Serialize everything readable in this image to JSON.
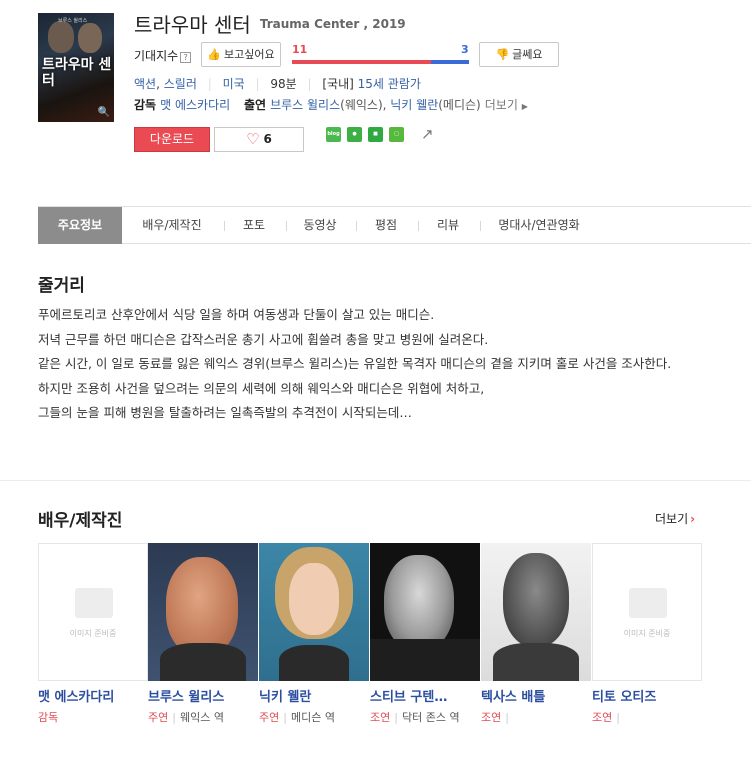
{
  "movie": {
    "title": "트라우마 센터",
    "subtitle": "Trauma Center , 2019",
    "poster_title": "트라우마 센터",
    "poster_cast": "브루스 윌리스"
  },
  "rating": {
    "label": "기대지수",
    "help": "?",
    "want_label": "보고싶어요",
    "meh_label": "글쎄요",
    "want_count": "11",
    "meh_count": "3",
    "want_fraction": 0.7857
  },
  "info": {
    "genre1": "액션",
    "genre2": "스릴러",
    "country": "미국",
    "runtime": "98분",
    "rating_prefix": "[국내]",
    "age": "15세 관람가"
  },
  "credits": {
    "director_label": "감독",
    "director": "맷 에스카다리",
    "cast_label": "출연",
    "actor1": "브루스 윌리스",
    "actor1_role": "(웨익스)",
    "actor2": "닉키 웰란",
    "actor2_role": "(메디슨)",
    "more": "더보기"
  },
  "actions": {
    "download": "다운로드",
    "like_count": "6",
    "share_icons": [
      "blog-icon",
      "talk-icon",
      "band-icon",
      "story-icon"
    ]
  },
  "tabs": [
    "주요정보",
    "배우/제작진",
    "포토",
    "동영상",
    "평점",
    "리뷰",
    "명대사/연관영화"
  ],
  "synopsis": {
    "heading": "줄거리",
    "lines": [
      "푸에르토리코 산후안에서 식당 일을 하며 여동생과 단둘이 살고 있는 매디슨.",
      " 저녁 근무를 하던 매디슨은 갑작스러운 총기 사고에 휩쓸려 총을 맞고 병원에 실려온다.",
      " 같은 시간, 이 일로 동료를 잃은 웨익스 경위(브루스 윌리스)는 유일한 목격자 매디슨의 곁을 지키며 홀로 사건을 조사한다.",
      " 하지만 조용히 사건을 덮으려는 의문의 세력에 의해 웨익스와 매디슨은 위협에 처하고,",
      " 그들의 눈을 피해 병원을 탈출하려는 일촉즉발의 추격전이 시작되는데…"
    ]
  },
  "cast_section": {
    "heading": "배우/제작진",
    "more": "더보기",
    "placeholder_text": "이미지 준비중",
    "members": [
      {
        "name": "맷 에스카다리",
        "type": "감독",
        "role": "",
        "photo": false
      },
      {
        "name": "브루스 윌리스",
        "type": "주연",
        "role": "웨익스 역",
        "photo": true
      },
      {
        "name": "닉키 웰란",
        "type": "주연",
        "role": "메디슨 역",
        "photo": true
      },
      {
        "name": "스티브 구텐…",
        "type": "조연",
        "role": "닥터 존스 역",
        "photo": true
      },
      {
        "name": "텍사스 배틀",
        "type": "조연",
        "role": "",
        "photo": true
      },
      {
        "name": "티토 오티즈",
        "type": "조연",
        "role": "",
        "photo": false
      }
    ]
  }
}
